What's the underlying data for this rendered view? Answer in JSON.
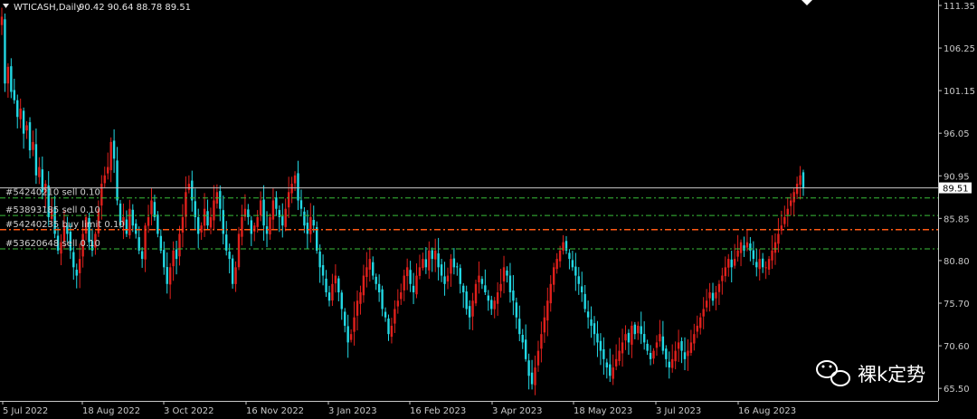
{
  "header": {
    "symbol_label": "WTICASH,Daily",
    "ohlc": "90.42 90.64 88.78 89.51"
  },
  "watermark": {
    "text": "裸k定势",
    "icon": "wechat-icon"
  },
  "colors": {
    "background": "#000000",
    "bull": "#e0201c",
    "bear": "#22d8e4",
    "order_line": "#3bbf3b",
    "order_line_active": "#ff5a14",
    "price_line": "#c8c8c8",
    "axis": "#c8c8c8"
  },
  "chart_data": {
    "type": "candlestick",
    "title": "WTICASH,Daily",
    "ylim": [
      64.0,
      112.0
    ],
    "y_ticks": [
      "111.35",
      "106.25",
      "101.15",
      "96.05",
      "90.95",
      "85.85",
      "80.80",
      "75.70",
      "70.60",
      "65.50"
    ],
    "x_ticks": [
      "5 Jul 2022",
      "18 Aug 2022",
      "3 Oct 2022",
      "16 Nov 2022",
      "3 Jan 2023",
      "16 Feb 2023",
      "3 Apr 2023",
      "18 May 2023",
      "3 Jul 2023",
      "16 Aug 2023"
    ],
    "last_price": "89.51",
    "orders": [
      {
        "label": "#54240210 sell 0.10",
        "price": 88.3
      },
      {
        "label": "#53893185 sell 0.10",
        "price": 86.2
      },
      {
        "label": "#54240235 buy limit 0.10",
        "price": 84.5
      },
      {
        "label": "#53620648 sell 0.10",
        "price": 82.2
      }
    ],
    "close_series": [
      110,
      102,
      104,
      101,
      100,
      98,
      99,
      96,
      97,
      94,
      95,
      91,
      92,
      89,
      90,
      86,
      87,
      84,
      82,
      83,
      85,
      84,
      82,
      80,
      79,
      81,
      84,
      86,
      83,
      82,
      84,
      87,
      90,
      91,
      92,
      95,
      93,
      88,
      85,
      86,
      84,
      87,
      85,
      84,
      82,
      81,
      85,
      86,
      88,
      86,
      84,
      82,
      80,
      78,
      80,
      82,
      81,
      84,
      86,
      89,
      90,
      88,
      86,
      84,
      85,
      87,
      85,
      86,
      88,
      89,
      87,
      84,
      82,
      81,
      78,
      80,
      84,
      86,
      87,
      86,
      84,
      85,
      86,
      88,
      85,
      84,
      86,
      88,
      87,
      86,
      85,
      87,
      89,
      90,
      91,
      88,
      87,
      85,
      84,
      86,
      85,
      82,
      80,
      79,
      77,
      76,
      78,
      79,
      77,
      75,
      73,
      71,
      72,
      74,
      76,
      77,
      79,
      80,
      81,
      79,
      78,
      77,
      75,
      74,
      72,
      73,
      75,
      76,
      77,
      79,
      80,
      78,
      77,
      79,
      80,
      81,
      80,
      82,
      81,
      82,
      80,
      79,
      78,
      79,
      81,
      80,
      80,
      78,
      77,
      75,
      74,
      76,
      78,
      79,
      78,
      77,
      76,
      75,
      76,
      77,
      78,
      80,
      79,
      77,
      76,
      74,
      72,
      71,
      69,
      67,
      66,
      68,
      70,
      72,
      74,
      76,
      78,
      80,
      81,
      82,
      83,
      82,
      81,
      80,
      79,
      78,
      77,
      75,
      74,
      73,
      72,
      71,
      70,
      69,
      68,
      67,
      68,
      69,
      70,
      71,
      72,
      71,
      73,
      72,
      73,
      72,
      71,
      70,
      69,
      70,
      71,
      72,
      70,
      69,
      68,
      69,
      70,
      71,
      70,
      69,
      70,
      71,
      72,
      73,
      74,
      75,
      76,
      77,
      76,
      77,
      78,
      79,
      80,
      81,
      80,
      81,
      82,
      83,
      82,
      83,
      82,
      81,
      80,
      81,
      80,
      80,
      81,
      82,
      83,
      84,
      85,
      86,
      87,
      88,
      89,
      90,
      91,
      89.51
    ]
  }
}
